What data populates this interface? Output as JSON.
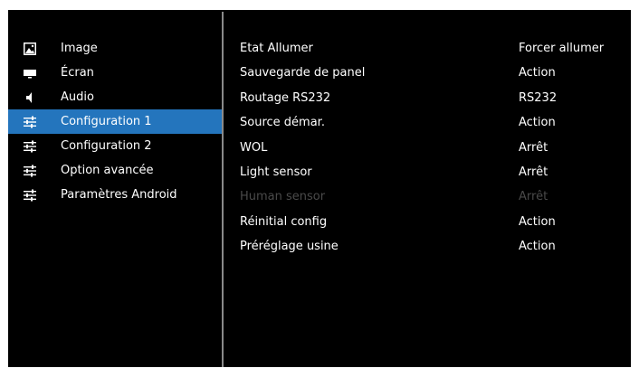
{
  "menu": {
    "items": [
      {
        "label": "Image",
        "icon": "image-icon"
      },
      {
        "label": "Écran",
        "icon": "screen-icon"
      },
      {
        "label": "Audio",
        "icon": "speaker-icon"
      },
      {
        "label": "Configuration 1",
        "icon": "sliders-icon",
        "selected": true
      },
      {
        "label": "Configuration 2",
        "icon": "sliders-icon"
      },
      {
        "label": "Option avancée",
        "icon": "sliders-icon"
      },
      {
        "label": "Paramètres Android",
        "icon": "sliders-icon"
      }
    ]
  },
  "settings": {
    "rows": [
      {
        "label": "Etat Allumer",
        "value": "Forcer allumer"
      },
      {
        "label": "Sauvegarde de panel",
        "value": "Action"
      },
      {
        "label": "Routage RS232",
        "value": "RS232"
      },
      {
        "label": "Source démar.",
        "value": "Action"
      },
      {
        "label": "WOL",
        "value": "Arrêt"
      },
      {
        "label": "Light sensor",
        "value": "Arrêt"
      },
      {
        "label": "Human sensor",
        "value": "Arrêt",
        "disabled": true
      },
      {
        "label": "Réinitial config",
        "value": "Action"
      },
      {
        "label": "Préréglage usine",
        "value": "Action"
      }
    ]
  },
  "colors": {
    "background": "#000000",
    "selected": "#2475bd",
    "text": "#ffffff",
    "disabled_text": "#4a4a4a",
    "divider": "#8a8a8a"
  }
}
